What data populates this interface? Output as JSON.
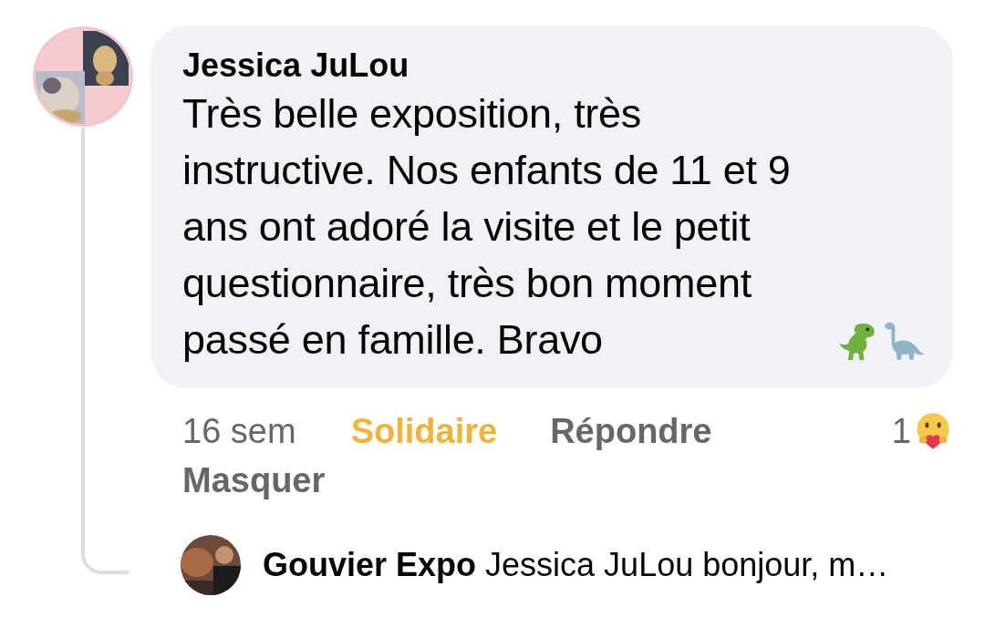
{
  "comment": {
    "author": "Jessica JuLou",
    "text": "Très belle exposition, très instructive. Nos enfants de 11 et 9 ans ont adoré la visite et le petit questionnaire, très bon moment passé en famille. Bravo",
    "time": "16 sem",
    "actions": [
      {
        "label": "Solidaire",
        "selected": true
      },
      {
        "label": "Répondre",
        "selected": false
      }
    ],
    "reaction_count": "1",
    "hide": "Masquer"
  },
  "reply": {
    "author": "Gouvier Expo",
    "text": "Jessica JuLou bonjour, m…"
  }
}
